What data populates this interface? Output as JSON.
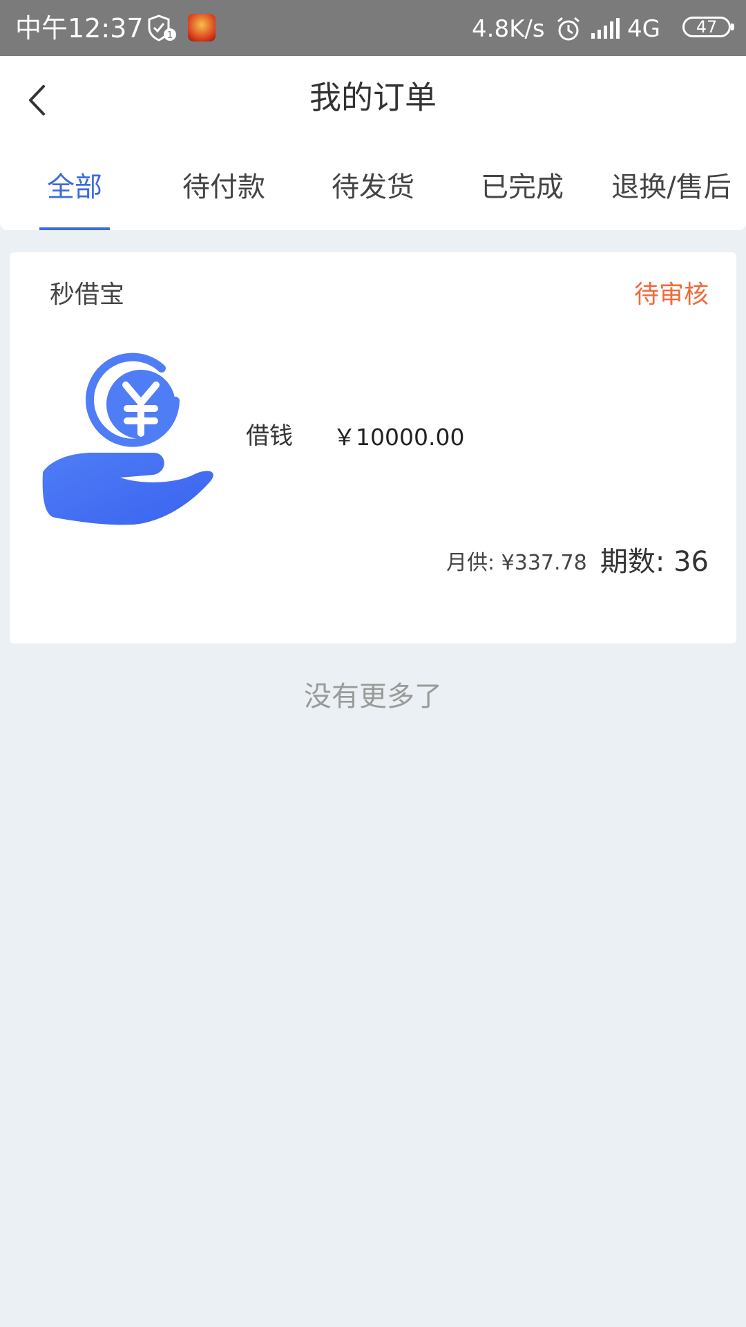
{
  "status_bar": {
    "time": "中午12:37",
    "net_speed": "4.8K/s",
    "network_type": "4G",
    "battery": "47",
    "icons": [
      "shield-check-icon",
      "game-app-icon",
      "alarm-icon",
      "signal-icon"
    ]
  },
  "header": {
    "title": "我的订单",
    "back_icon": "chevron-left-icon"
  },
  "tabs": [
    {
      "label": "全部",
      "active": true
    },
    {
      "label": "待付款",
      "active": false
    },
    {
      "label": "待发货",
      "active": false
    },
    {
      "label": "已完成",
      "active": false
    },
    {
      "label": "退换/售后",
      "active": false
    }
  ],
  "orders": [
    {
      "shop": "秒借宝",
      "status": "待审核",
      "product_name": "借钱",
      "amount": "￥10000.00",
      "monthly_payment": "月供: ¥337.78",
      "installments": "期数: 36",
      "image_icon": "hand-yuan-coin-icon"
    }
  ],
  "footer_text": "没有更多了",
  "colors": {
    "accent": "#3b6be0",
    "status_pending": "#ef6b3b",
    "background": "#eaf0f3",
    "status_bar": "#7b7b7b"
  }
}
